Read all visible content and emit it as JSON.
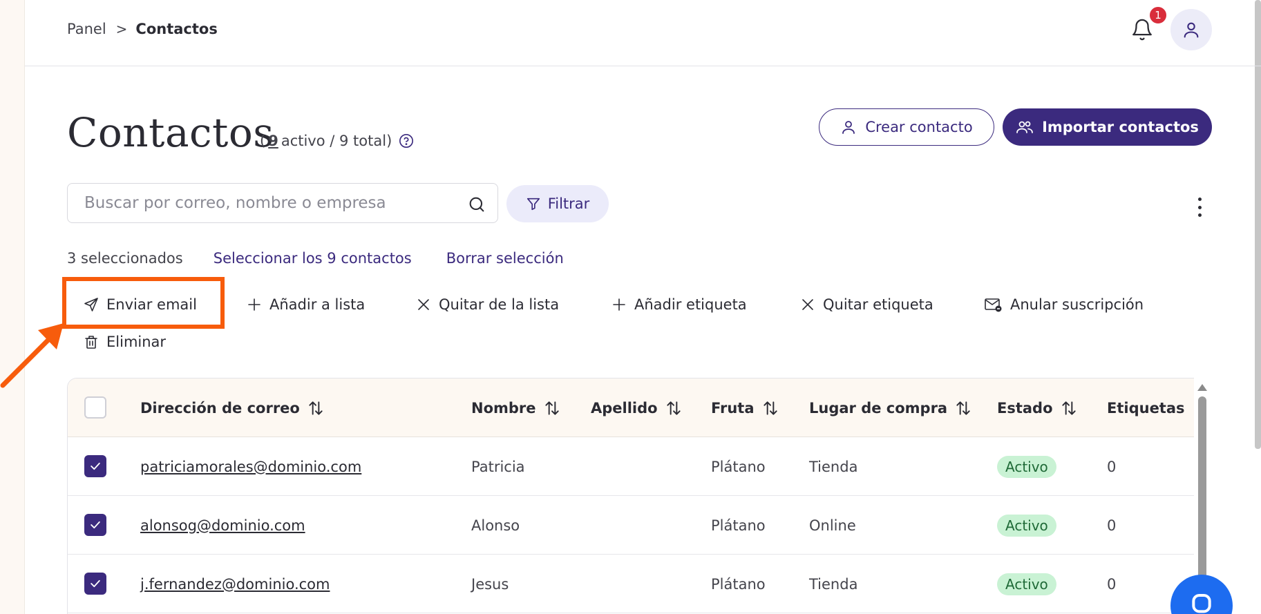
{
  "breadcrumb": {
    "root": "Panel",
    "separator": ">",
    "current": "Contactos"
  },
  "notifications": {
    "count": "1"
  },
  "page": {
    "title": "Contactos",
    "count_open": "(",
    "active_count": "9",
    "active_label": "activo / 9 total)"
  },
  "buttons": {
    "create": "Crear contacto",
    "import": "Importar contactos",
    "filter": "Filtrar"
  },
  "search": {
    "placeholder": "Buscar por correo, nombre o empresa",
    "value": ""
  },
  "selection": {
    "count": "3 seleccionados",
    "select_all": "Seleccionar los 9 contactos",
    "clear": "Borrar selección"
  },
  "actions": {
    "send_email": "Enviar email",
    "add_to_list": "Añadir a lista",
    "remove_from_list": "Quitar de la lista",
    "add_tag": "Añadir etiqueta",
    "remove_tag": "Quitar etiqueta",
    "unsubscribe": "Anular suscripción",
    "delete": "Eliminar"
  },
  "table": {
    "columns": [
      "Dirección de correo",
      "Nombre",
      "Apellido",
      "Fruta",
      "Lugar de compra",
      "Estado",
      "Etiquetas"
    ],
    "rows": [
      {
        "email": "patriciamorales@dominio.com",
        "first": "Patricia",
        "last": "",
        "fruit": "Plátano",
        "place": "Tienda",
        "status": "Activo",
        "tags": "0",
        "checked": true
      },
      {
        "email": "alonsog@dominio.com",
        "first": "Alonso",
        "last": "",
        "fruit": "Plátano",
        "place": "Online",
        "status": "Activo",
        "tags": "0",
        "checked": true
      },
      {
        "email": "j.fernandez@dominio.com",
        "first": "Jesus",
        "last": "",
        "fruit": "Plátano",
        "place": "Tienda",
        "status": "Activo",
        "tags": "0",
        "checked": true
      }
    ]
  },
  "colors": {
    "primary": "#3b2a7e",
    "highlight": "#f75c0c",
    "badge": "#d92d3b",
    "status_bg": "#c9f2d4",
    "header_bg": "#fdf8f2",
    "chat": "#1d6cf0"
  }
}
